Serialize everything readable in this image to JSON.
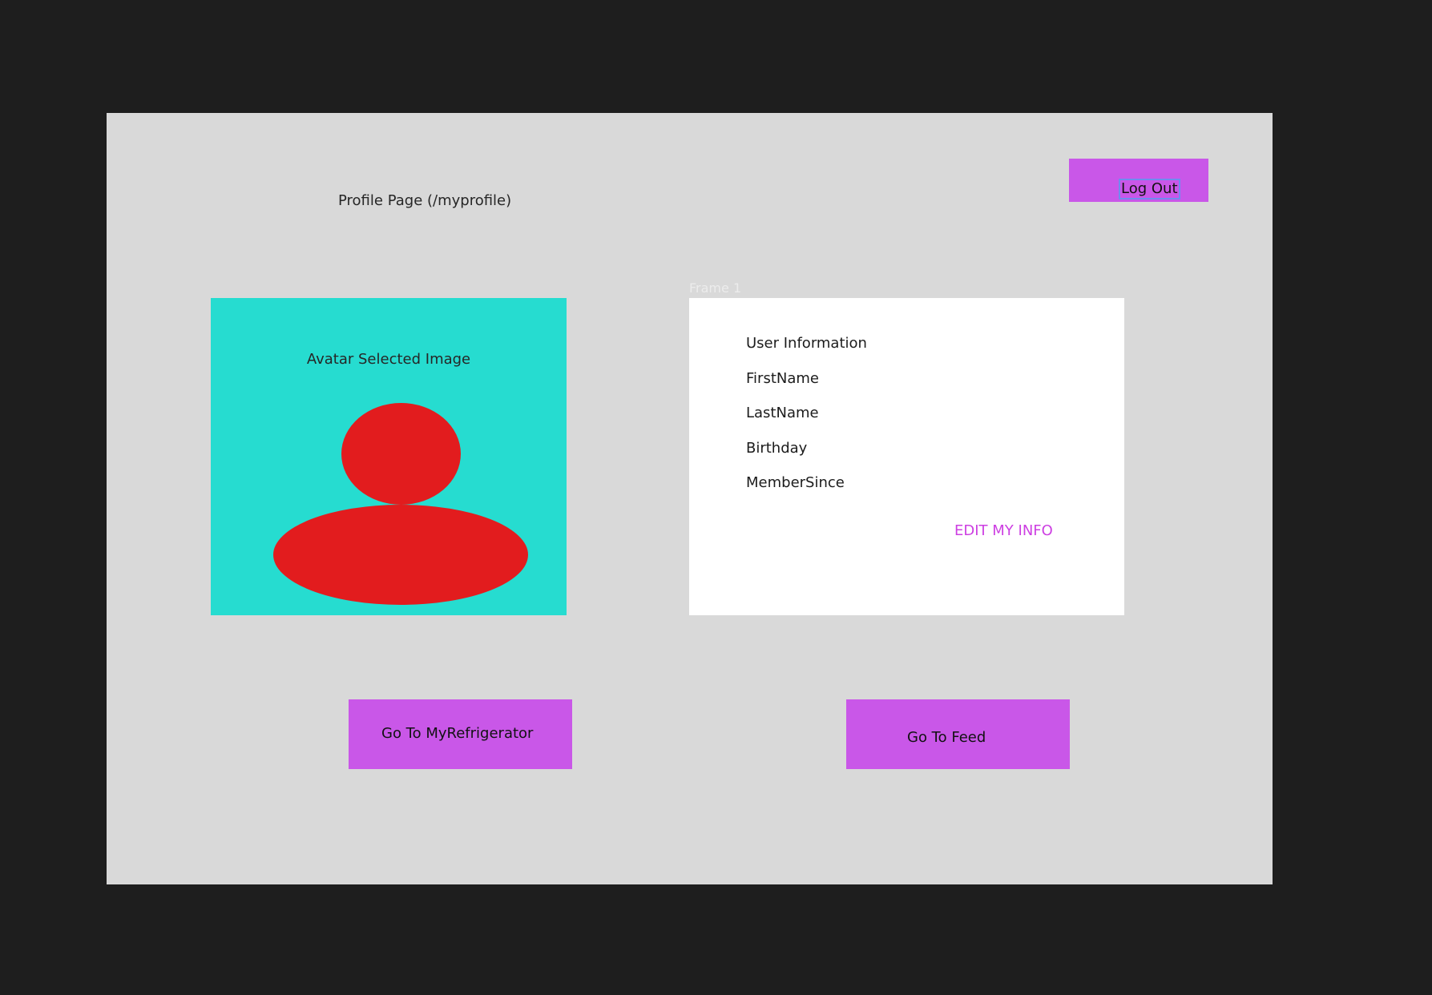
{
  "page": {
    "title": "Profile Page (/myprofile)",
    "logout_label": "Log Out"
  },
  "avatar": {
    "caption": "Avatar Selected Image",
    "icon": "person-placeholder-icon"
  },
  "frame": {
    "label": "Frame 1"
  },
  "user_info": {
    "heading": "User Information",
    "fields": [
      "FirstName",
      "LastName",
      "Birthday",
      "MemberSince"
    ],
    "edit_label": "EDIT MY INFO"
  },
  "navigation": {
    "refrigerator_label": "Go To MyRefrigerator",
    "feed_label": "Go To Feed"
  },
  "colors": {
    "canvas_background": "#1e1e1e",
    "page_background": "#d9d9d9",
    "button": "#c957e8",
    "avatar_background": "#26dcd0",
    "avatar_figure": "#e21c1e",
    "edit_link": "#cd3fe2",
    "selection_outline": "#6f8cf0"
  }
}
